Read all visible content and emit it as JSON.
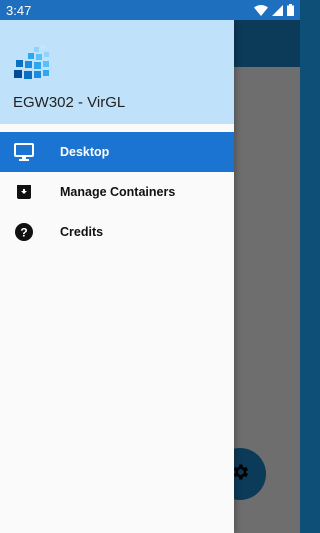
{
  "status_bar": {
    "time": "3:47",
    "icons": [
      "wifi-icon",
      "cellular-signal-icon",
      "battery-icon"
    ]
  },
  "drawer": {
    "app_title": "EGW302 - VirGL",
    "logo_icon": "cube-grid-logo",
    "items": [
      {
        "label": "Desktop",
        "icon": "monitor-icon",
        "active": true
      },
      {
        "label": "Manage Containers",
        "icon": "archive-box-icon",
        "active": false
      },
      {
        "label": "Credits",
        "icon": "help-circle-icon",
        "active": false
      }
    ]
  },
  "background": {
    "fab_icon": "gear-icon"
  },
  "colors": {
    "accent": "#1b74d1",
    "header": "#bfe2fa",
    "statusbar": "#1f6fbf",
    "scrim": "#6e6e6e"
  }
}
